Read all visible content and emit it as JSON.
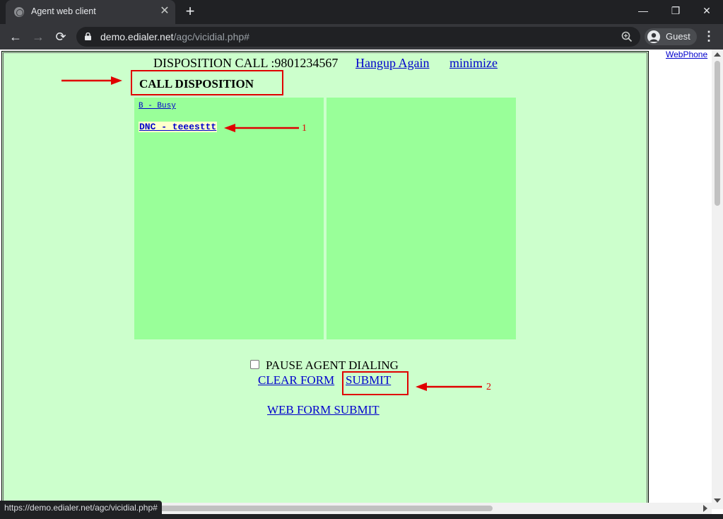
{
  "browser": {
    "tab_title": "Agent web client",
    "tab_close": "✕",
    "new_tab": "+",
    "window_controls": {
      "minimize": "—",
      "restore": "❐",
      "close": "✕"
    },
    "nav": {
      "back": "←",
      "forward": "→",
      "reload": "⟳"
    },
    "url_host": "demo.edialer.net",
    "url_path": "/agc/vicidial.php#",
    "profile_label": "Guest",
    "menu": "⋮",
    "status_url": "https://demo.edialer.net/agc/vicidial.php#"
  },
  "disposition": {
    "header_prefix": "DISPOSITION CALL :",
    "phone_number": "9801234567",
    "hangup_again": "Hangup Again",
    "minimize": "minimize",
    "title": "CALL DISPOSITION",
    "items": [
      {
        "label": "B - Busy"
      },
      {
        "label": "DNC - teeesttt"
      }
    ],
    "pause_label": "PAUSE AGENT DIALING",
    "pause_checked": false,
    "clear_form": "CLEAR FORM",
    "submit": "SUBMIT",
    "web_form_submit": "WEB FORM SUBMIT"
  },
  "annotations": {
    "num1": "1",
    "num2": "2",
    "color": "#e00000"
  },
  "sidebar": {
    "webphone": "WebPhone"
  },
  "colors": {
    "panel_bg": "#ccffcc",
    "column_bg": "#99ff99",
    "link": "#0000cc",
    "selected_bg": "#ffffcc"
  }
}
